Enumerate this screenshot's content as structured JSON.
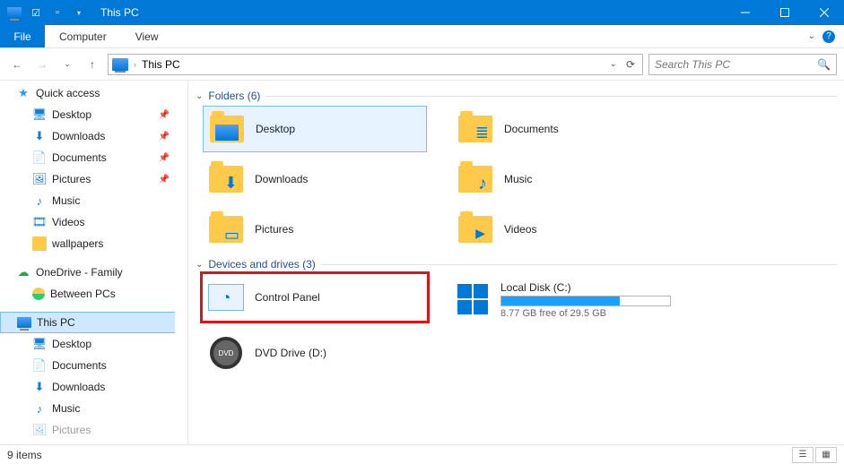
{
  "title": "This PC",
  "ribbon": {
    "file": "File",
    "tabs": [
      "Computer",
      "View"
    ]
  },
  "address": {
    "path": "This PC"
  },
  "search": {
    "placeholder": "Search This PC"
  },
  "sidebar": {
    "quick_access": "Quick access",
    "items": [
      {
        "label": "Desktop",
        "pin": true
      },
      {
        "label": "Downloads",
        "pin": true
      },
      {
        "label": "Documents",
        "pin": true
      },
      {
        "label": "Pictures",
        "pin": true
      },
      {
        "label": "Music"
      },
      {
        "label": "Videos"
      },
      {
        "label": "wallpapers"
      }
    ],
    "onedrive": "OneDrive - Family",
    "between": "Between PCs",
    "thispc": "This PC",
    "pc_items": [
      {
        "label": "Desktop"
      },
      {
        "label": "Documents"
      },
      {
        "label": "Downloads"
      },
      {
        "label": "Music"
      },
      {
        "label": "Pictures"
      }
    ]
  },
  "groups": {
    "folders": {
      "title": "Folders (6)",
      "items": [
        "Desktop",
        "Documents",
        "Downloads",
        "Music",
        "Pictures",
        "Videos"
      ]
    },
    "drives": {
      "title": "Devices and drives (3)",
      "control_panel": "Control Panel",
      "local": {
        "label": "Local Disk (C:)",
        "free": "8.77 GB free of 29.5 GB",
        "pct": 70
      },
      "dvd": "DVD Drive (D:)"
    }
  },
  "status": "9 items"
}
